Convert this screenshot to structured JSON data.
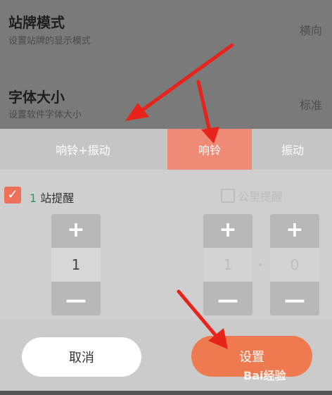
{
  "settings": {
    "station_mode": {
      "title": "站牌模式",
      "subtitle": "设置站牌的显示模式",
      "value": "横向"
    },
    "font_size": {
      "title": "字体大小",
      "subtitle": "设置软件字体大小",
      "value": "标准"
    }
  },
  "modes": {
    "tabs": [
      {
        "label": "响铃+振动"
      },
      {
        "label": "响铃"
      },
      {
        "label": "振动"
      }
    ],
    "active_index": 1
  },
  "reminder": {
    "station_count": "1",
    "station_label": "站提醒",
    "station_checked": true,
    "check_glyph": "✓",
    "km_label": "公里提醒",
    "km_checked": false
  },
  "steppers": {
    "plus": "+",
    "minus": "—",
    "station_value": "1",
    "km_integer": "1",
    "km_decimal": "0"
  },
  "actions": {
    "cancel_label": "取消",
    "confirm_label": "设置"
  },
  "watermark": "Bai经验",
  "colors": {
    "accent": "#f07a50",
    "active_tab": "#ef8a76",
    "checkbox": "#ef7058",
    "arrow": "#e8231a"
  }
}
